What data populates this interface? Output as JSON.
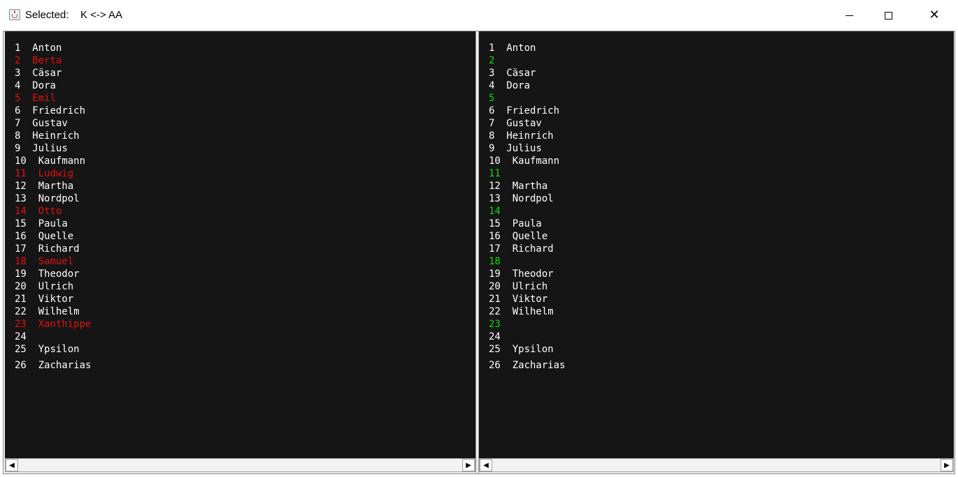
{
  "window": {
    "title": "Selected:    K <-> AA",
    "icon": "java-cup-icon",
    "controls": {
      "minimize": "minimize-icon",
      "maximize": "maximize-icon",
      "close": "close-icon"
    }
  },
  "colors": {
    "background": "#151515",
    "normal": "#ffffff",
    "removed": "#e01010",
    "added": "#11d811"
  },
  "left_pane": {
    "lines": [
      {
        "num": "1",
        "text": "Anton",
        "status": "normal"
      },
      {
        "num": "2",
        "text": "Berta",
        "status": "removed"
      },
      {
        "num": "3",
        "text": "Cäsar",
        "status": "normal"
      },
      {
        "num": "4",
        "text": "Dora",
        "status": "normal"
      },
      {
        "num": "5",
        "text": "Emil",
        "status": "removed"
      },
      {
        "num": "6",
        "text": "Friedrich",
        "status": "normal"
      },
      {
        "num": "7",
        "text": "Gustav",
        "status": "normal"
      },
      {
        "num": "8",
        "text": "Heinrich",
        "status": "normal"
      },
      {
        "num": "9",
        "text": "Julius",
        "status": "normal"
      },
      {
        "num": "10",
        "text": "Kaufmann",
        "status": "normal"
      },
      {
        "num": "11",
        "text": "Ludwig",
        "status": "removed"
      },
      {
        "num": "12",
        "text": "Martha",
        "status": "normal"
      },
      {
        "num": "13",
        "text": "Nordpol",
        "status": "normal"
      },
      {
        "num": "14",
        "text": "Otto",
        "status": "removed"
      },
      {
        "num": "15",
        "text": "Paula",
        "status": "normal"
      },
      {
        "num": "16",
        "text": "Quelle",
        "status": "normal"
      },
      {
        "num": "17",
        "text": "Richard",
        "status": "normal"
      },
      {
        "num": "18",
        "text": "Samuel",
        "status": "removed"
      },
      {
        "num": "19",
        "text": "Theodor",
        "status": "normal"
      },
      {
        "num": "20",
        "text": "Ulrich",
        "status": "normal"
      },
      {
        "num": "21",
        "text": "Viktor",
        "status": "normal"
      },
      {
        "num": "22",
        "text": "Wilhelm",
        "status": "normal"
      },
      {
        "num": "23",
        "text": "Xanthippe",
        "status": "removed"
      },
      {
        "num": "24",
        "text": "",
        "status": "normal"
      },
      {
        "num": "25",
        "text": "Ypsilon",
        "status": "normal"
      },
      {
        "num": "26",
        "text": "Zacharias",
        "status": "normal"
      }
    ]
  },
  "right_pane": {
    "lines": [
      {
        "num": "1",
        "text": "Anton",
        "status": "normal"
      },
      {
        "num": "2",
        "text": "",
        "status": "added"
      },
      {
        "num": "3",
        "text": "Cäsar",
        "status": "normal"
      },
      {
        "num": "4",
        "text": "Dora",
        "status": "normal"
      },
      {
        "num": "5",
        "text": "",
        "status": "added"
      },
      {
        "num": "6",
        "text": "Friedrich",
        "status": "normal"
      },
      {
        "num": "7",
        "text": "Gustav",
        "status": "normal"
      },
      {
        "num": "8",
        "text": "Heinrich",
        "status": "normal"
      },
      {
        "num": "9",
        "text": "Julius",
        "status": "normal"
      },
      {
        "num": "10",
        "text": "Kaufmann",
        "status": "normal"
      },
      {
        "num": "11",
        "text": "",
        "status": "added"
      },
      {
        "num": "12",
        "text": "Martha",
        "status": "normal"
      },
      {
        "num": "13",
        "text": "Nordpol",
        "status": "normal"
      },
      {
        "num": "14",
        "text": "",
        "status": "added"
      },
      {
        "num": "15",
        "text": "Paula",
        "status": "normal"
      },
      {
        "num": "16",
        "text": "Quelle",
        "status": "normal"
      },
      {
        "num": "17",
        "text": "Richard",
        "status": "normal"
      },
      {
        "num": "18",
        "text": "",
        "status": "added"
      },
      {
        "num": "19",
        "text": "Theodor",
        "status": "normal"
      },
      {
        "num": "20",
        "text": "Ulrich",
        "status": "normal"
      },
      {
        "num": "21",
        "text": "Viktor",
        "status": "normal"
      },
      {
        "num": "22",
        "text": "Wilhelm",
        "status": "normal"
      },
      {
        "num": "23",
        "text": "",
        "status": "added"
      },
      {
        "num": "24",
        "text": "",
        "status": "normal"
      },
      {
        "num": "25",
        "text": "Ypsilon",
        "status": "normal"
      },
      {
        "num": "26",
        "text": "Zacharias",
        "status": "normal"
      }
    ]
  },
  "scrollbars": {
    "left_arrow": "◀",
    "right_arrow": "▶"
  }
}
